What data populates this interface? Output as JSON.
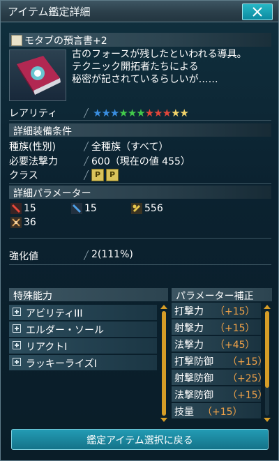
{
  "window": {
    "title": "アイテム鑑定詳細",
    "close_symbol": "✕"
  },
  "item": {
    "name": "モタブの預言書+2",
    "description": [
      "古のフォースが残したといわれる導具。",
      "テクニック開拓者たちによる",
      "秘密が記されているらしいが……"
    ],
    "rarity_label": "レアリティ",
    "rarity_stars": [
      {
        "char": "★",
        "color": "#3a8ee0"
      },
      {
        "char": "★",
        "color": "#3a8ee0"
      },
      {
        "char": "★",
        "color": "#3a8ee0"
      },
      {
        "char": "★",
        "color": "#41c94a"
      },
      {
        "char": "★",
        "color": "#41c94a"
      },
      {
        "char": "★",
        "color": "#41c94a"
      },
      {
        "char": "★",
        "color": "#e0463a"
      },
      {
        "char": "★",
        "color": "#e0463a"
      },
      {
        "char": "★",
        "color": "#e0463a"
      },
      {
        "char": "★",
        "color": "#f2d46a"
      },
      {
        "char": "★",
        "color": "#f2d46a"
      }
    ]
  },
  "requirements": {
    "header": "詳細装備条件",
    "race_label": "種族(性別)",
    "race_value": "全種族（すべて）",
    "tech_label": "必要法撃力",
    "tech_value": "600（現在の値 455）",
    "class_label": "クラス",
    "class_icons": [
      "P",
      "P"
    ]
  },
  "parameters": {
    "header": "詳細パラメーター",
    "stats": [
      {
        "icon": "melee-attack-icon",
        "value": "15"
      },
      {
        "icon": "ranged-attack-icon",
        "value": "15"
      },
      {
        "icon": "tech-attack-icon",
        "value": "556"
      },
      {
        "icon": "dexterity-icon",
        "value": "36"
      }
    ],
    "grind_label": "強化値",
    "grind_value": "2(111%)"
  },
  "abilities": {
    "header": "特殊能力",
    "items": [
      "アビリティIII",
      "エルダー・ソール",
      "リアクトI",
      "ラッキーライズI"
    ]
  },
  "bonuses": {
    "header": "パラメーター補正",
    "items": [
      {
        "name": "打撃力",
        "value": "（+15）"
      },
      {
        "name": "射撃力",
        "value": "（+15）"
      },
      {
        "name": "法撃力",
        "value": "（+45）"
      },
      {
        "name": "打撃防御",
        "value": "（+15）"
      },
      {
        "name": "射撃防御",
        "value": "（+25）"
      },
      {
        "name": "法撃防御",
        "value": "（+15）"
      },
      {
        "name": "技量",
        "value": "（+15）"
      }
    ]
  },
  "footer": {
    "back_button": "鑑定アイテム選択に戻る"
  },
  "colors": {
    "accent": "#1f93ad",
    "bonus_value": "#f0a248",
    "scroll": "#d59d27"
  }
}
